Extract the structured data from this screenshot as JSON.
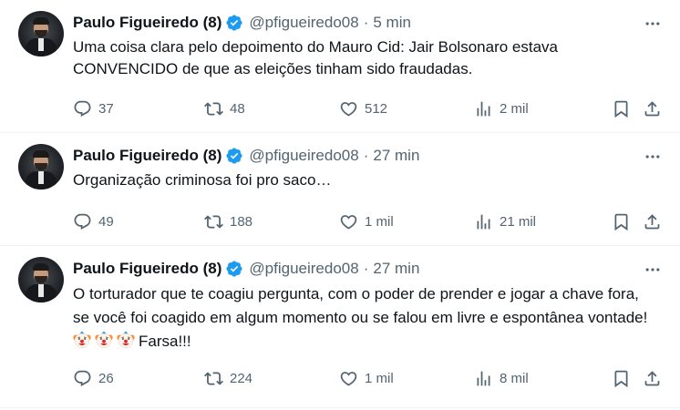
{
  "tweets": [
    {
      "author_name": "Paulo Figueiredo (8)",
      "handle": "@pfigueiredo08",
      "separator": "·",
      "time": "5 min",
      "text": "Uma coisa clara pelo depoimento do Mauro Cid: Jair Bolsonaro estava CONVENCIDO de que as eleições tinham sido fraudadas.",
      "replies": "37",
      "retweets": "48",
      "likes": "512",
      "views": "2 mil"
    },
    {
      "author_name": "Paulo Figueiredo (8)",
      "handle": "@pfigueiredo08",
      "separator": "·",
      "time": "27 min",
      "text": "Organização criminosa foi pro saco…",
      "replies": "49",
      "retweets": "188",
      "likes": "1 mil",
      "views": "21 mil"
    },
    {
      "author_name": "Paulo Figueiredo (8)",
      "handle": "@pfigueiredo08",
      "separator": "·",
      "time": "27 min",
      "text": "O torturador que te coagiu pergunta, com o poder de prender e jogar a chave fora, se você foi coagido em algum momento ou se falou em livre e espontânea vontade! ",
      "text_tail": "Farsa!!!",
      "emoji_icon": "clown-face-icon",
      "replies": "26",
      "retweets": "224",
      "likes": "1 mil",
      "views": "8 mil"
    }
  ],
  "colors": {
    "text": "#0f1419",
    "secondary": "#536471",
    "verified": "#1d9bf0",
    "divider": "#eff3f4"
  }
}
